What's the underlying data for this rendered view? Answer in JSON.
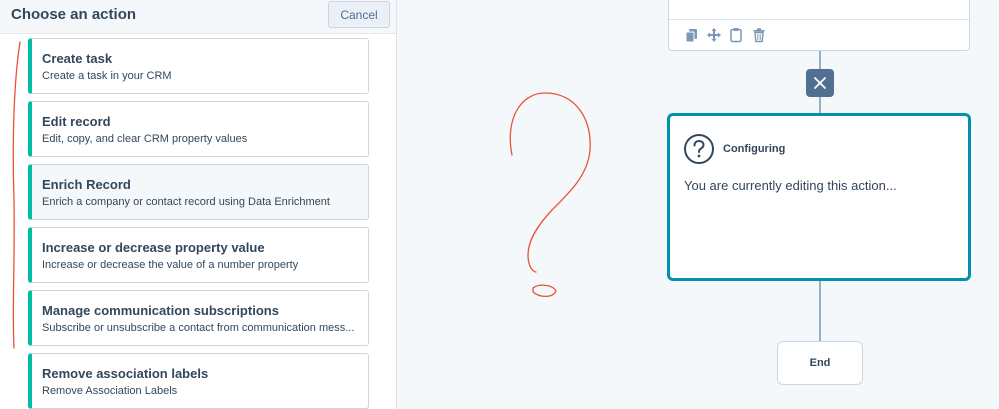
{
  "panel": {
    "title": "Choose an action",
    "cancel_label": "Cancel",
    "actions": [
      {
        "title": "Create task",
        "description": "Create a task in your CRM"
      },
      {
        "title": "Edit record",
        "description": "Edit, copy, and clear CRM property values"
      },
      {
        "title": "Enrich Record",
        "description": "Enrich a company or contact record using Data Enrichment"
      },
      {
        "title": "Increase or decrease property value",
        "description": "Increase or decrease the value of a number property"
      },
      {
        "title": "Manage communication subscriptions",
        "description": "Subscribe or unsubscribe a contact from communication mess..."
      },
      {
        "title": "Remove association labels",
        "description": "Remove Association Labels"
      }
    ]
  },
  "canvas": {
    "toolbar_icons": [
      "copy-icon",
      "move-icon",
      "clipboard-icon",
      "trash-icon"
    ],
    "close_icon": "close-icon",
    "configuring": {
      "title": "Configuring",
      "text": "You are currently editing this action...",
      "icon": "question-circle-icon"
    },
    "end_label": "End"
  },
  "colors": {
    "accent": "#00bda5",
    "active_border": "#0091ae",
    "close_node": "#516f90",
    "annotation": "#e8533a"
  }
}
